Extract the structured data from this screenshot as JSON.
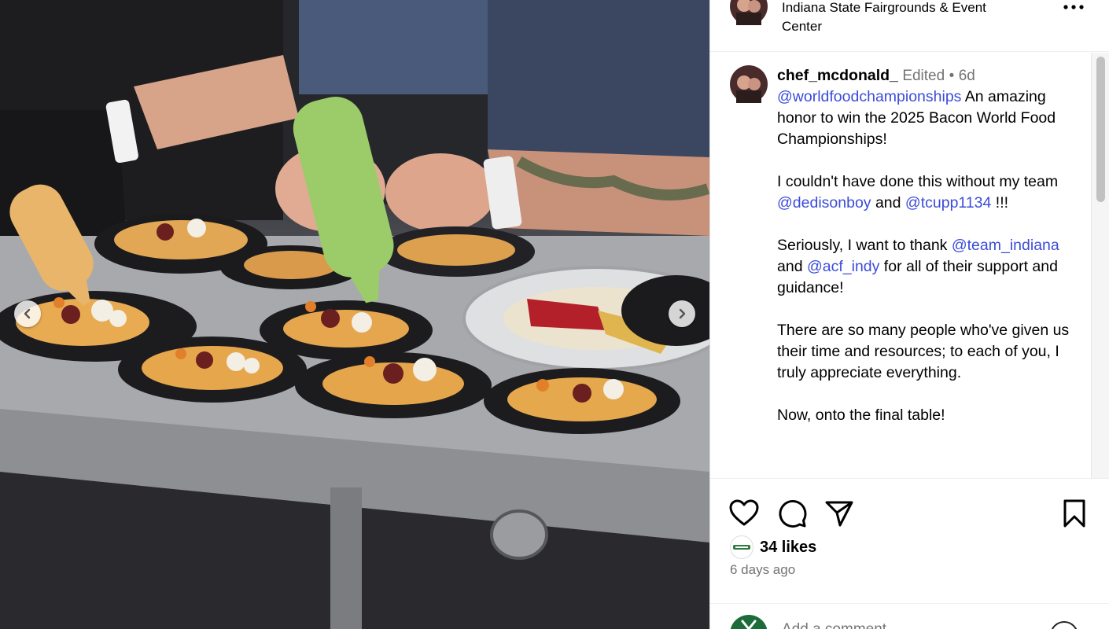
{
  "post": {
    "location": "Indiana State Fairgrounds & Event Center",
    "username": "chef_mcdonald_",
    "edited_label": "Edited",
    "separator": "•",
    "time_ago": "6d",
    "caption": {
      "p1": {
        "mention": "@worldfoodchampionships",
        "text": " An amazing honor to win the 2025 Bacon World Food Championships!"
      },
      "p2": {
        "text_a": "I couldn't have done this without my team ",
        "mention_a": "@dedisonboy",
        "text_b": " and ",
        "mention_b": "@tcupp1134",
        "text_c": " !!!"
      },
      "p3": {
        "text_a": "Seriously, I want to thank ",
        "mention_a": "@team_indiana",
        "text_b": " and ",
        "mention_b": "@acf_indy",
        "text_c": " for all of their support and guidance!"
      },
      "p4": "There are so many people who've given us their time and resources; to each of you, I truly appreciate everything.",
      "p5": "Now, onto the final table!"
    },
    "likes": "34 likes",
    "date": "6 days ago",
    "comment_placeholder": "Add a comment..."
  },
  "icons": {
    "like": "heart-icon",
    "comment": "comment-icon",
    "share": "send-icon",
    "save": "bookmark-icon",
    "more": "more-icon",
    "emoji": "emoji-icon",
    "prev": "chevron-left-icon",
    "next": "chevron-right-icon"
  },
  "colors": {
    "mention": "#3b4cd9",
    "secondary_text": "#737373"
  }
}
